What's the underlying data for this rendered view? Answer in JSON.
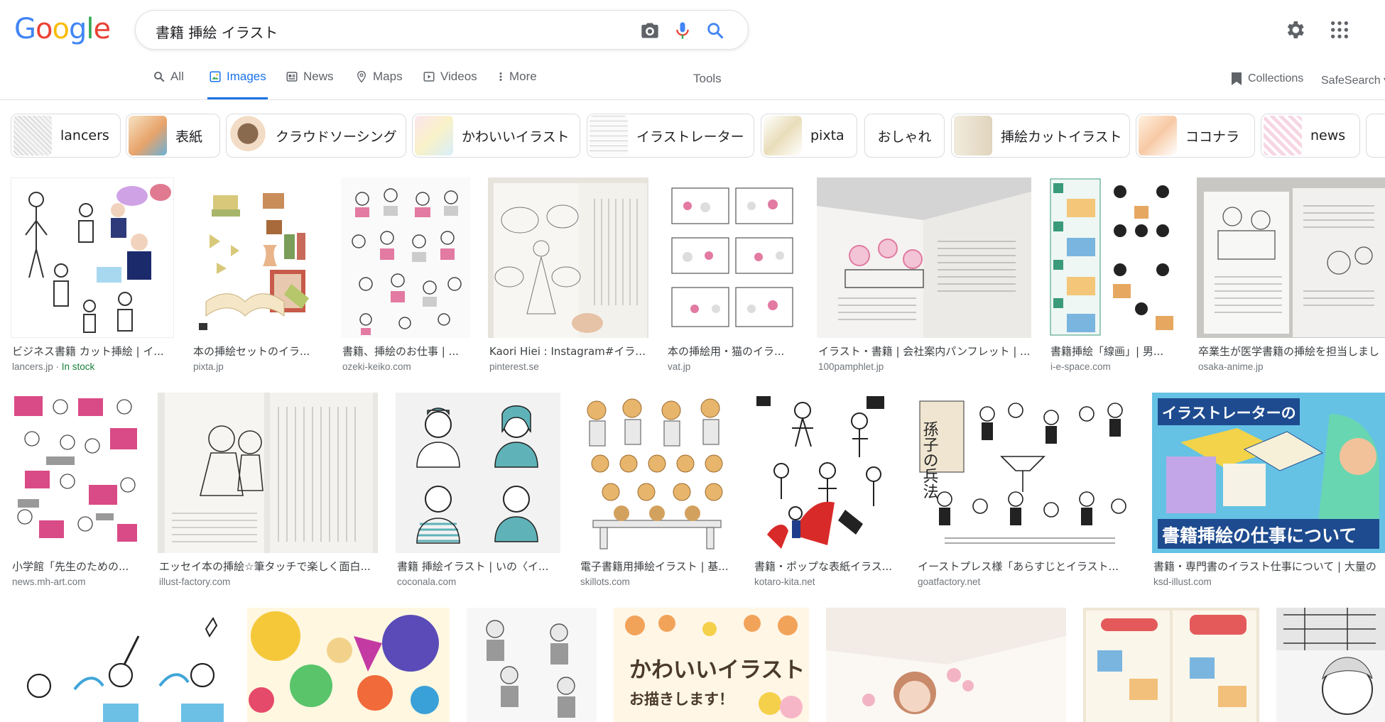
{
  "logo": "Google",
  "search": {
    "query": "書籍 挿絵 イラスト"
  },
  "tabs": [
    {
      "label": "All",
      "icon": "search-icon"
    },
    {
      "label": "Images",
      "icon": "image-icon"
    },
    {
      "label": "News",
      "icon": "newspaper-icon"
    },
    {
      "label": "Maps",
      "icon": "map-pin-icon"
    },
    {
      "label": "Videos",
      "icon": "video-icon"
    },
    {
      "label": "More",
      "icon": "more-vert-icon"
    }
  ],
  "tools_label": "Tools",
  "collections_label": "Collections",
  "safesearch_label": "SafeSearch",
  "chips": [
    "lancers",
    "表紙",
    "クラウドソーシング",
    "かわいいイラスト",
    "イラストレーター",
    "pixta",
    "おしゃれ",
    "挿絵カットイラスト",
    "ココナラ",
    "news"
  ],
  "results": [
    {
      "caption": "ビジネス書籍 カット挿絵 | イ...",
      "source": "lancers.jp",
      "badge": "In stock"
    },
    {
      "caption": "本の挿絵セットのイラ...",
      "source": "pixta.jp"
    },
    {
      "caption": "書籍、挿絵のお仕事 | ...",
      "source": "ozeki-keiko.com"
    },
    {
      "caption": "Kaori Hiei : Instagram#イラス...",
      "source": "pinterest.se"
    },
    {
      "caption": "本の挿絵用・猫のイラ...",
      "source": "vat.jp"
    },
    {
      "caption": "イラスト・書籍 | 会社案内パンフレット | ...",
      "source": "100pamphlet.jp"
    },
    {
      "caption": "書籍挿絵「線画」| 男...",
      "source": "i-e-space.com"
    },
    {
      "caption": "卒業生が医学書籍の挿絵を担当しまし",
      "source": "osaka-anime.jp"
    },
    {
      "caption": "小学館「先生のための...",
      "source": "news.mh-art.com"
    },
    {
      "caption": "エッセイ本の挿絵☆筆タッチで楽しく面白...",
      "source": "illust-factory.com"
    },
    {
      "caption": "書籍 挿絵イラスト | いの〈イ...",
      "source": "coconala.com"
    },
    {
      "caption": "電子書籍用挿絵イラスト | 基...",
      "source": "skillots.com"
    },
    {
      "caption": "書籍・ポップな表紙イラス...",
      "source": "kotaro-kita.net"
    },
    {
      "caption": "イーストプレス様「あらすじとイラスト...",
      "source": "goatfactory.net"
    },
    {
      "caption": "書籍・専門書のイラスト仕事について | 大量の",
      "source": "ksd-illust.com"
    }
  ],
  "image_text": {
    "r15_top": "イラストレーターの",
    "r15_bottom": "書籍挿絵の仕事について",
    "r14_book": "孫子の兵法",
    "r19_a": "かわいいイラスト",
    "r19_b": "お描きします！"
  },
  "colors": {
    "accent": "#1a73e8",
    "pink": "#e0457b",
    "teal": "#5fb3b8"
  }
}
